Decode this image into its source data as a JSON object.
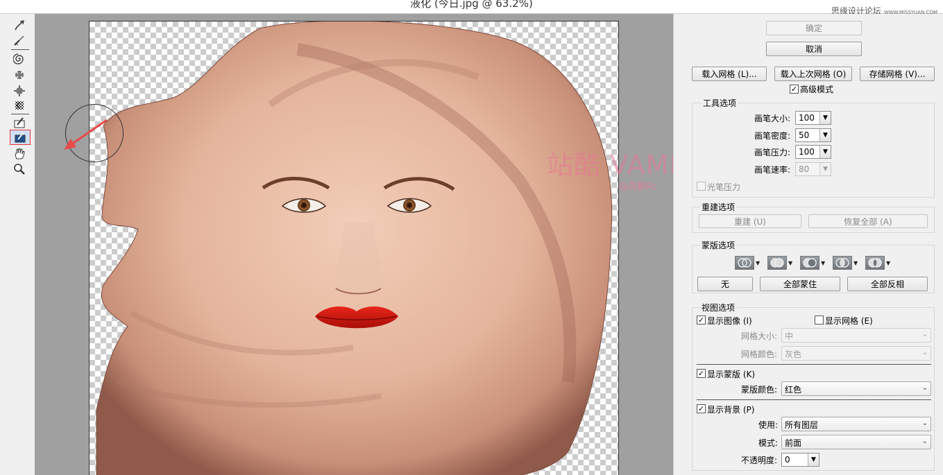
{
  "window": {
    "title": "液化 (今日.jpg @ 63.2%)",
    "site_watermark": "思缘设计论坛",
    "site_url": "WWW.MISSYUAN.COM"
  },
  "toolbar": {
    "tools": [
      {
        "name": "forward-warp-icon",
        "glyph": "warp"
      },
      {
        "name": "reconstruct-icon",
        "glyph": "reconstruct"
      },
      {
        "name": "twirl-clockwise-icon",
        "glyph": "twirl"
      },
      {
        "name": "pucker-icon",
        "glyph": "pucker"
      },
      {
        "name": "bloat-icon",
        "glyph": "bloat"
      },
      {
        "name": "push-left-icon",
        "glyph": "push"
      },
      {
        "name": "freeze-mask-icon",
        "glyph": "freeze"
      },
      {
        "name": "thaw-mask-icon",
        "glyph": "thaw",
        "selected": true
      },
      {
        "name": "hand-icon",
        "glyph": "hand"
      },
      {
        "name": "zoom-icon",
        "glyph": "zoom"
      }
    ]
  },
  "canvas": {
    "watermark_main": "站酷 VAMPIREE",
    "watermark_author": "@周鹏Rc"
  },
  "panel": {
    "ok_label": "确定",
    "cancel_label": "取消",
    "load_mesh_label": "载入网格 (L)...",
    "load_last_mesh_label": "载入上次网格 (O)",
    "save_mesh_label": "存储网格 (V)...",
    "advanced_mode_label": "高级模式",
    "advanced_mode_checked": true,
    "tool_options": {
      "title": "工具选项",
      "brush_size_label": "画笔大小:",
      "brush_size_value": "100",
      "brush_density_label": "画笔密度:",
      "brush_density_value": "50",
      "brush_pressure_label": "画笔压力:",
      "brush_pressure_value": "100",
      "brush_rate_label": "画笔速率:",
      "brush_rate_value": "80",
      "stylus_pressure_label": "光笔压力",
      "stylus_pressure_checked": false
    },
    "reconstruct_options": {
      "title": "重建选项",
      "reconstruct_label": "重建 (U)",
      "restore_all_label": "恢复全部 (A)"
    },
    "mask_options": {
      "title": "蒙版选项",
      "none_label": "无",
      "mask_all_label": "全部蒙住",
      "invert_all_label": "全部反相"
    },
    "view_options": {
      "title": "视图选项",
      "show_image_label": "显示图像 (I)",
      "show_image_checked": true,
      "show_mesh_label": "显示网格 (E)",
      "show_mesh_checked": false,
      "mesh_size_label": "网格大小:",
      "mesh_size_value": "中",
      "mesh_color_label": "网格颜色:",
      "mesh_color_value": "灰色",
      "show_mask_label": "显示蒙版 (K)",
      "show_mask_checked": true,
      "mask_color_label": "蒙版颜色:",
      "mask_color_value": "红色",
      "show_backdrop_label": "显示背景 (P)",
      "show_backdrop_checked": true,
      "use_label": "使用:",
      "use_value": "所有图层",
      "mode_label": "模式:",
      "mode_value": "前面",
      "opacity_label": "不透明度:",
      "opacity_value": "0"
    }
  },
  "colors": {
    "lips": "#d41a12",
    "skin": "#e6b8a0",
    "watermark": "#e67896",
    "selection_outline": "#ee3333"
  }
}
